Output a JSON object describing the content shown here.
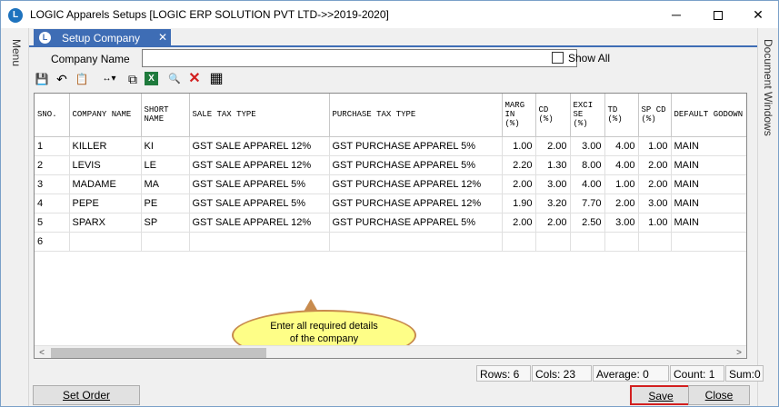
{
  "window": {
    "title": "LOGIC Apparels Setups  [LOGIC ERP SOLUTION PVT LTD->>2019-2020]",
    "app_icon": "L",
    "minimize": "─",
    "close": "✕"
  },
  "left_panel": {
    "label": "Menu"
  },
  "right_panel": {
    "label": "Document Windows"
  },
  "tab": {
    "label": "Setup Company",
    "close": "✕",
    "icon": "L"
  },
  "filter": {
    "label": "Company Name",
    "value": "",
    "show_all_label": "Show All",
    "show_all_checked": false
  },
  "toolbar": {
    "save": "💾",
    "undo": "↶",
    "notes": "📋",
    "columns": "↔▾",
    "copy": "⧉",
    "excel": "X",
    "find": "🔍",
    "delete": "✕",
    "grid": "▦"
  },
  "grid": {
    "columns": [
      "SNO.",
      "COMPANY NAME",
      "SHORT NAME",
      "SALE TAX TYPE",
      "PURCHASE TAX TYPE",
      "MARGIN (%)",
      "CD (%)",
      "EXCISE (%)",
      "TD (%)",
      "SP CD (%)",
      "DEFAULT GODOWN"
    ],
    "headers": {
      "sno": "SNO.",
      "company_name": "COMPANY NAME",
      "short_name": "SHORT NAME",
      "sale_tax": "SALE TAX TYPE",
      "purchase_tax": "PURCHASE TAX TYPE",
      "margin": "MARG IN (%)",
      "cd": "CD (%)",
      "excise": "EXCI SE (%)",
      "td": "TD (%)",
      "spcd": "SP CD (%)",
      "godown": "DEFAULT GODOWN"
    },
    "rows": [
      {
        "sno": "1",
        "company": "KILLER",
        "short": "KI",
        "sale_tax": "GST SALE APPAREL 12%",
        "purchase_tax": "GST PURCHASE APPAREL 5%",
        "margin": "1.00",
        "cd": "2.00",
        "excise": "3.00",
        "td": "4.00",
        "spcd": "1.00",
        "godown": "MAIN"
      },
      {
        "sno": "2",
        "company": "LEVIS",
        "short": "LE",
        "sale_tax": "GST SALE APPAREL 12%",
        "purchase_tax": "GST PURCHASE APPAREL 5%",
        "margin": "2.20",
        "cd": "1.30",
        "excise": "8.00",
        "td": "4.00",
        "spcd": "2.00",
        "godown": "MAIN"
      },
      {
        "sno": "3",
        "company": "MADAME",
        "short": "MA",
        "sale_tax": "GST SALE APPAREL 5%",
        "purchase_tax": "GST PURCHASE APPAREL 12%",
        "margin": "2.00",
        "cd": "3.00",
        "excise": "4.00",
        "td": "1.00",
        "spcd": "2.00",
        "godown": "MAIN"
      },
      {
        "sno": "4",
        "company": "PEPE",
        "short": "PE",
        "sale_tax": "GST SALE APPAREL 5%",
        "purchase_tax": "GST PURCHASE APPAREL 12%",
        "margin": "1.90",
        "cd": "3.20",
        "excise": "7.70",
        "td": "2.00",
        "spcd": "3.00",
        "godown": "MAIN"
      },
      {
        "sno": "5",
        "company": "SPARX",
        "short": "SP",
        "sale_tax": "GST SALE APPAREL 12%",
        "purchase_tax": "GST PURCHASE APPAREL 5%",
        "margin": "2.00",
        "cd": "2.00",
        "excise": "2.50",
        "td": "3.00",
        "spcd": "1.00",
        "godown": "MAIN"
      },
      {
        "sno": "6",
        "company": "",
        "short": "",
        "sale_tax": "",
        "purchase_tax": "",
        "margin": "",
        "cd": "",
        "excise": "",
        "td": "",
        "spcd": "",
        "godown": ""
      }
    ],
    "scroll_left": "<",
    "scroll_right": ">"
  },
  "callout": {
    "line1": "Enter  all  required  details",
    "line2": "of  the  company",
    "fill_color": "#fefe87",
    "border_color": "#c88b4e"
  },
  "status": {
    "rows": "Rows: 6",
    "cols": "Cols: 23",
    "average": "Average: 0",
    "count": "Count: 1",
    "sum": "Sum:0"
  },
  "buttons": {
    "set_order": "Set Order",
    "save": "Save",
    "close": "Close",
    "highlight_color": "#d21f1f"
  },
  "colors": {
    "accent": "#3e6db5"
  }
}
